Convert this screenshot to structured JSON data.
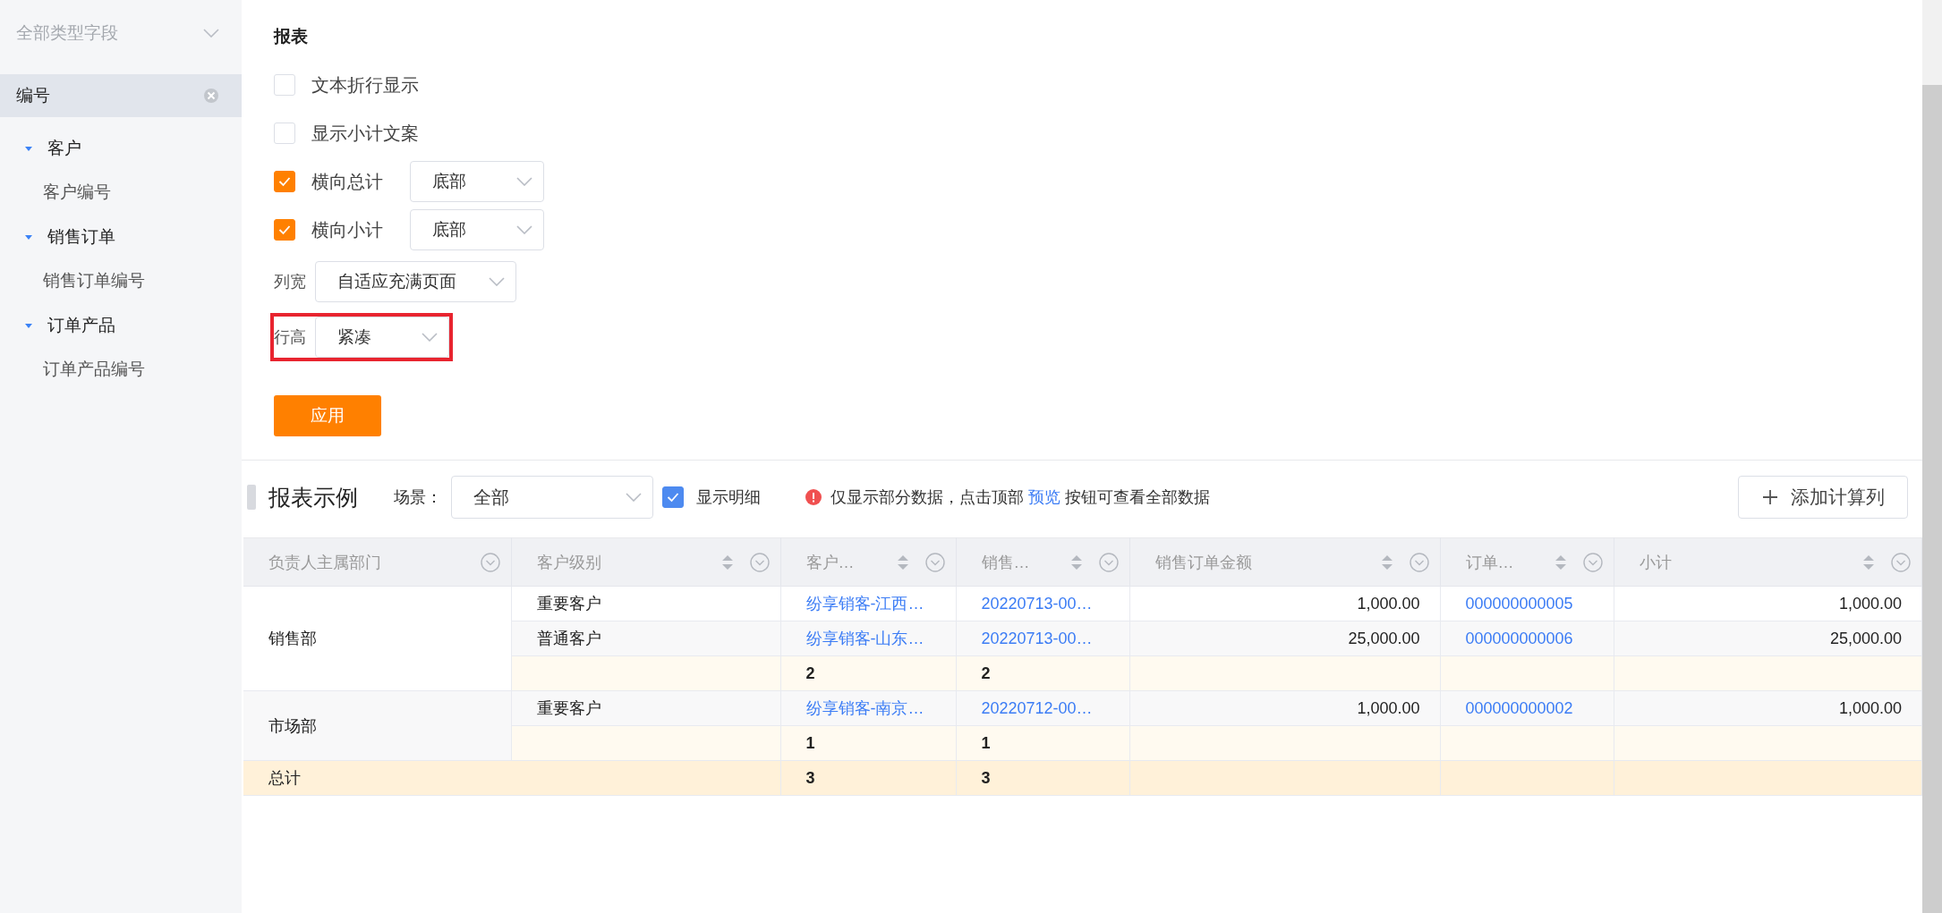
{
  "sidebar": {
    "header": {
      "label": "全部类型字段"
    },
    "items": [
      {
        "kind": "field",
        "label": "编号",
        "selected": true
      },
      {
        "kind": "group",
        "label": "客户",
        "expanded": true,
        "children": [
          {
            "label": "客户编号",
            "selected": false
          }
        ]
      },
      {
        "kind": "group",
        "label": "销售订单",
        "expanded": true,
        "children": [
          {
            "label": "销售订单编号",
            "selected": false
          }
        ]
      },
      {
        "kind": "group",
        "label": "订单产品",
        "expanded": true,
        "children": [
          {
            "label": "订单产品编号",
            "selected": false
          }
        ]
      }
    ]
  },
  "settings": {
    "title": "报表",
    "options": [
      {
        "label": "文本折行显示",
        "checked": false
      },
      {
        "label": "显示小计文案",
        "checked": false
      },
      {
        "label": "横向总计",
        "checked": true,
        "select": {
          "value": "底部"
        }
      },
      {
        "label": "横向小计",
        "checked": true,
        "select": {
          "value": "底部"
        }
      }
    ],
    "fields": [
      {
        "label": "列宽",
        "value": "自适应充满页面",
        "highlighted": false
      },
      {
        "label": "行高",
        "value": "紧凑",
        "highlighted": true
      }
    ],
    "apply_button": "应用"
  },
  "toolbar": {
    "title": "报表示例",
    "scene_label": "场景：",
    "scene_value": "全部",
    "show_detail": {
      "label": "显示明细",
      "checked": true
    },
    "notice": {
      "before": "仅显示部分数据，点击顶部 ",
      "link": "预览",
      "after": " 按钮可查看全部数据"
    },
    "add_button": "添加计算列"
  },
  "table": {
    "columns": [
      {
        "label": "负责人主属部门",
        "kind": "text",
        "sortable": false
      },
      {
        "label": "客户级别",
        "kind": "text",
        "sortable": true
      },
      {
        "label": "客户…",
        "kind": "link",
        "sortable": true
      },
      {
        "label": "销售…",
        "kind": "link",
        "sortable": true
      },
      {
        "label": "销售订单金额",
        "kind": "amount",
        "sortable": true
      },
      {
        "label": "订单…",
        "kind": "link",
        "sortable": true
      },
      {
        "label": "小计",
        "kind": "amount",
        "sortable": true
      }
    ],
    "groups": [
      {
        "label": "销售部",
        "rows": [
          [
            "重要客户",
            "纷享销客-江西…",
            "20220713-00…",
            "1,000.00",
            "000000000005",
            "1,000.00"
          ],
          [
            "普通客户",
            "纷享销客-山东…",
            "20220713-00…",
            "25,000.00",
            "000000000006",
            "25,000.00"
          ]
        ],
        "subtotal": {
          "column_3": "2",
          "column_4": "2"
        }
      },
      {
        "label": "市场部",
        "rows": [
          [
            "重要客户",
            "纷享销客-南京…",
            "20220712-00…",
            "1,000.00",
            "000000000002",
            "1,000.00"
          ]
        ],
        "subtotal": {
          "column_3": "1",
          "column_4": "1"
        }
      }
    ],
    "total": {
      "label": "总计",
      "column_3": "3",
      "column_4": "3"
    }
  }
}
